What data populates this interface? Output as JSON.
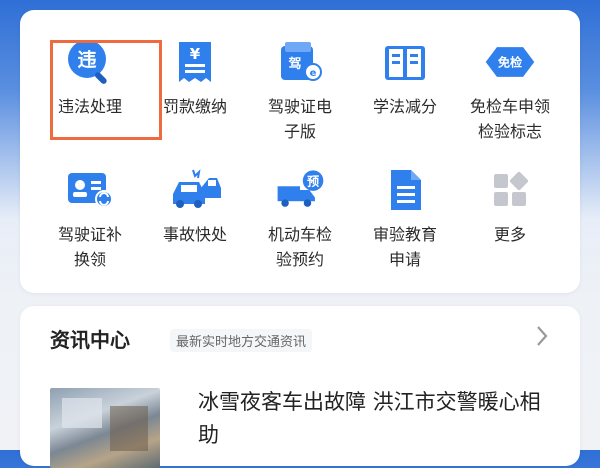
{
  "services": {
    "row1": [
      {
        "id": "violation",
        "label": "违法处理",
        "icon": "violation-search-icon",
        "badge": "违",
        "highlighted": true
      },
      {
        "id": "fine",
        "label": "罚款缴纳",
        "icon": "fine-receipt-icon",
        "badge": "¥"
      },
      {
        "id": "elicense",
        "label": "驾驶证电\n子版",
        "icon": "license-wallet-icon",
        "badge": "驾"
      },
      {
        "id": "study",
        "label": "学法减分",
        "icon": "book-icon"
      },
      {
        "id": "exempt",
        "label": "免检车申领\n检验标志",
        "icon": "exempt-badge-icon",
        "badge": "免检"
      }
    ],
    "row2": [
      {
        "id": "renew",
        "label": "驾驶证补\n换领",
        "icon": "license-renew-icon"
      },
      {
        "id": "accident",
        "label": "事故快处",
        "icon": "car-accident-icon"
      },
      {
        "id": "inspect",
        "label": "机动车检\n验预约",
        "icon": "truck-booking-icon",
        "badge": "预"
      },
      {
        "id": "edu",
        "label": "审验教育\n申请",
        "icon": "document-icon"
      },
      {
        "id": "more",
        "label": "更多",
        "icon": "more-grid-icon"
      }
    ]
  },
  "news": {
    "title": "资讯中心",
    "subtitle": "最新实时地方交通资讯",
    "article_headline": "冰雪夜客车出故障 洪江市交警暖心相助"
  },
  "colors": {
    "brand_blue": "#2f80ed",
    "highlight": "#ee6a3f"
  }
}
